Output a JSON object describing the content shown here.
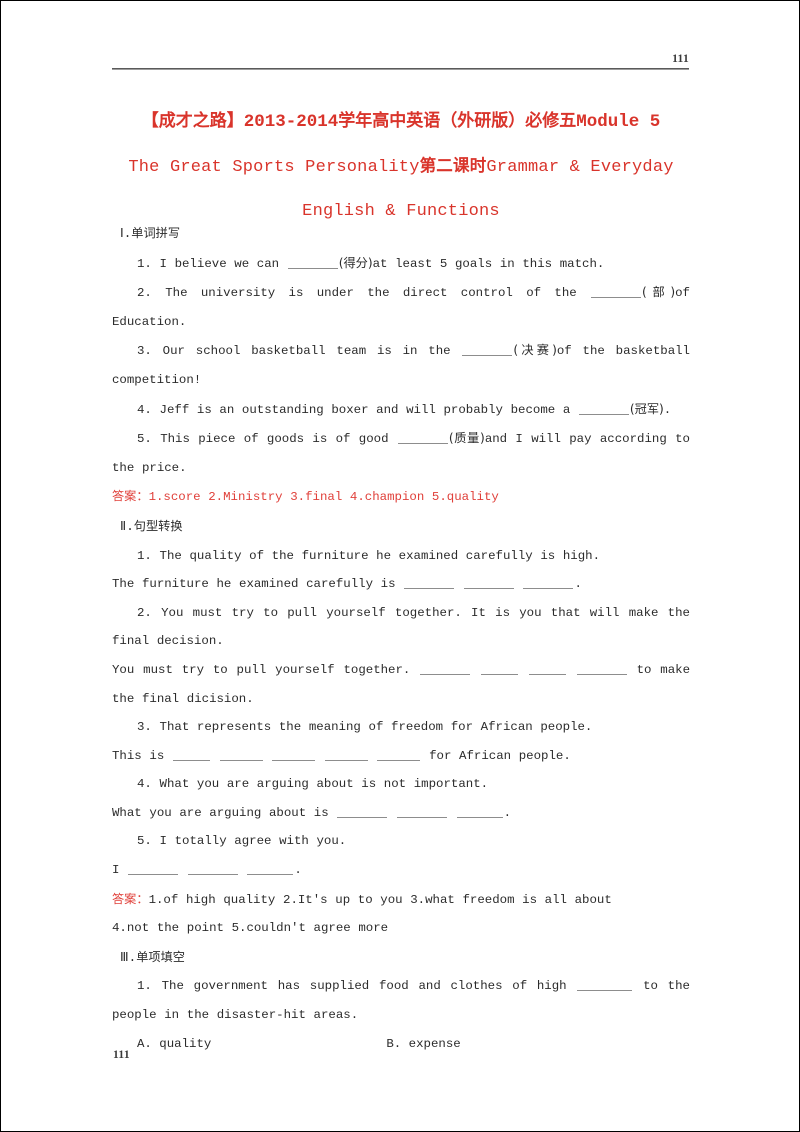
{
  "header": {
    "page_number": "111"
  },
  "footer": {
    "page_number": "111"
  },
  "title": {
    "line1_part1": "【成才之路】",
    "line1_part2": "2013-2014",
    "line1_part3": "学年高中英语（外研版）必修五",
    "line1_part4": "Module 5",
    "line2_part1": "The Great Sports Personality",
    "line2_part2": "第二课时",
    "line2_part3": "Grammar & Everyday",
    "line3": "English & Functions",
    "color": "#d9342b"
  },
  "sections": {
    "s1": {
      "heading_num": "Ⅰ.",
      "heading_cn": "单词拼写",
      "q1_a": "1. I believe we can ",
      "q1_hint": "(得分)",
      "q1_b": "at least 5 goals in this match.",
      "q2_a": "2. The university is under the direct control of the ",
      "q2_hint": "(部)",
      "q2_b": "of Education.",
      "q3_a": "3. Our school basketball team is in the ",
      "q3_hint": "(决赛)",
      "q3_b": "of the basketball competition!",
      "q4_a": "4. Jeff is an outstanding boxer and will probably become a ",
      "q4_hint": "(冠军)",
      "q4_b": ".",
      "q5_a": "5. This piece of goods is of good ",
      "q5_hint": "(质量)",
      "q5_b": "and I will pay according to the price.",
      "answer_label": "答案：",
      "answer_text": "1.score  2.Ministry  3.final  4.champion  5.quality"
    },
    "s2": {
      "heading_num": "Ⅱ.",
      "heading_cn": "句型转换",
      "q1": "1. The quality of the furniture he examined carefully is high.",
      "q1_ans_a": "The furniture he examined carefully is ",
      "q1_ans_b": ".",
      "q2": "2. You must try to pull yourself together. It is you that will make the final decision.",
      "q2_ans_a": "You must try to pull yourself together. ",
      "q2_ans_b": " to make the final dicision.",
      "q3": "3. That represents the meaning of freedom for African people.",
      "q3_ans_a": "This is ",
      "q3_ans_b": " for African people.",
      "q4": "4. What you are arguing about is not important.",
      "q4_ans_a": "What you are arguing about is ",
      "q4_ans_b": ".",
      "q5": "5. I totally agree with you.",
      "q5_ans_a": "I ",
      "q5_ans_b": ".",
      "answer_label": "答案：",
      "answer_text_1": "1.of high quality  2.It's up to you  3.what freedom is all about",
      "answer_text_2": "4.not the point  5.couldn't agree more"
    },
    "s3": {
      "heading_num": "Ⅲ.",
      "heading_cn": "单项填空",
      "q1_a": "1. The government has supplied food and clothes of high ",
      "q1_b": " to the people in the disaster-hit areas.",
      "q1_optA": "A. quality",
      "q1_optB": "B. expense"
    }
  }
}
